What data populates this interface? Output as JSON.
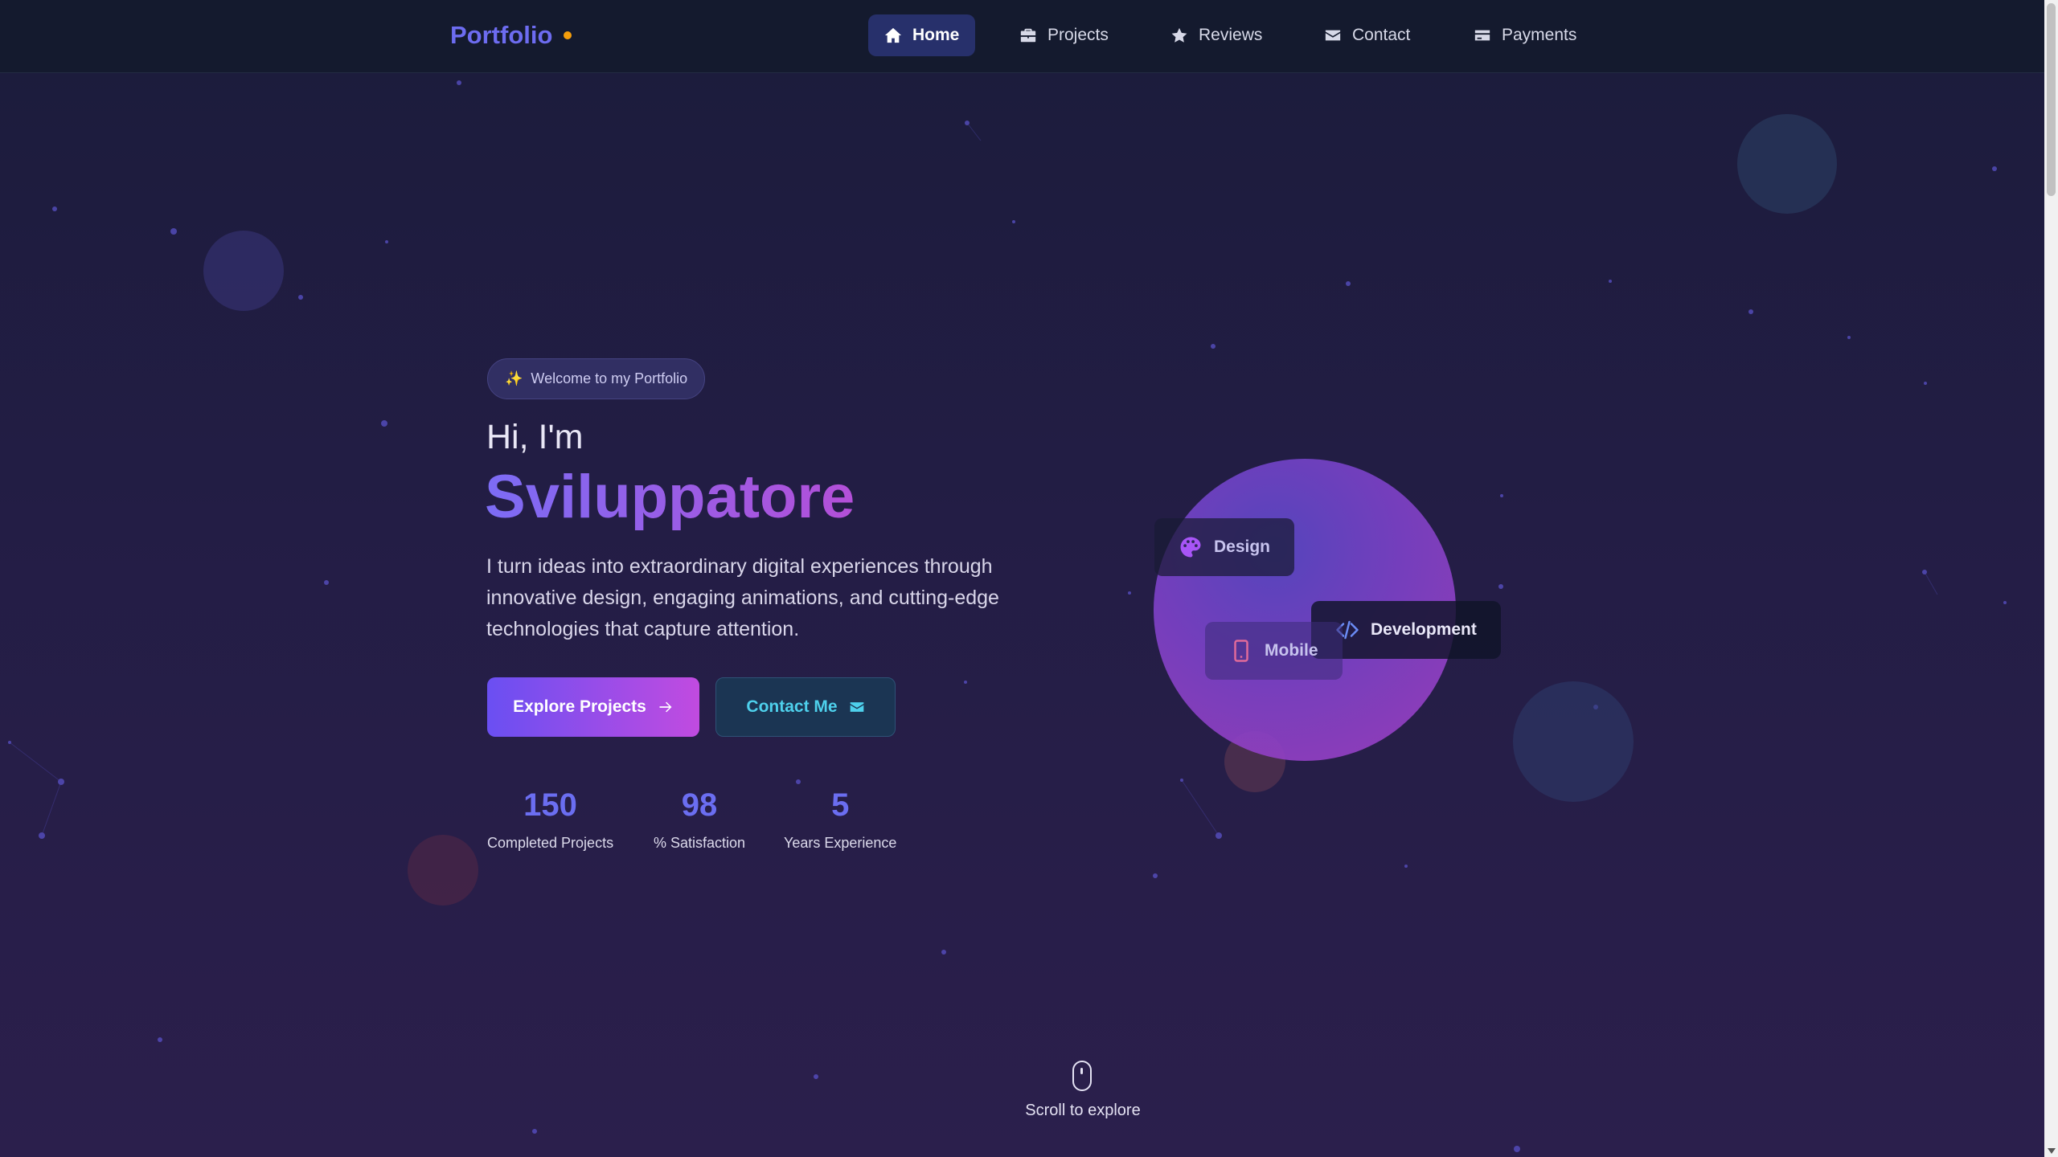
{
  "nav": {
    "brand": "Portfolio",
    "items": [
      {
        "label": "Home",
        "icon": "home-icon",
        "active": true
      },
      {
        "label": "Projects",
        "icon": "briefcase-icon",
        "active": false
      },
      {
        "label": "Reviews",
        "icon": "star-icon",
        "active": false
      },
      {
        "label": "Contact",
        "icon": "envelope-icon",
        "active": false
      },
      {
        "label": "Payments",
        "icon": "credit-card-icon",
        "active": false
      }
    ]
  },
  "hero": {
    "badge": "Welcome to my Portfolio",
    "greeting": "Hi, I'm",
    "name": "Sviluppatore",
    "description": "I turn ideas into extraordinary digital experiences through innovative design, engaging animations, and cutting-edge technologies that capture attention.",
    "primary_button": "Explore Projects",
    "secondary_button": "Contact Me",
    "stats": [
      {
        "value": "150",
        "label": "Completed Projects"
      },
      {
        "value": "98",
        "label": "% Satisfaction"
      },
      {
        "value": "5",
        "label": "Years Experience"
      }
    ]
  },
  "visual": {
    "chips": [
      {
        "label": "Design",
        "icon": "palette-icon"
      },
      {
        "label": "Mobile",
        "icon": "smartphone-icon"
      },
      {
        "label": "Development",
        "icon": "code-icon"
      }
    ]
  },
  "scroll_hint": "Scroll to explore",
  "colors": {
    "accent": "#6d6cf0",
    "gradient_start": "#6a4ff2",
    "gradient_end": "#c14be0",
    "secondary_text": "#4ed0ec",
    "brand_dot": "#f59e0b"
  }
}
